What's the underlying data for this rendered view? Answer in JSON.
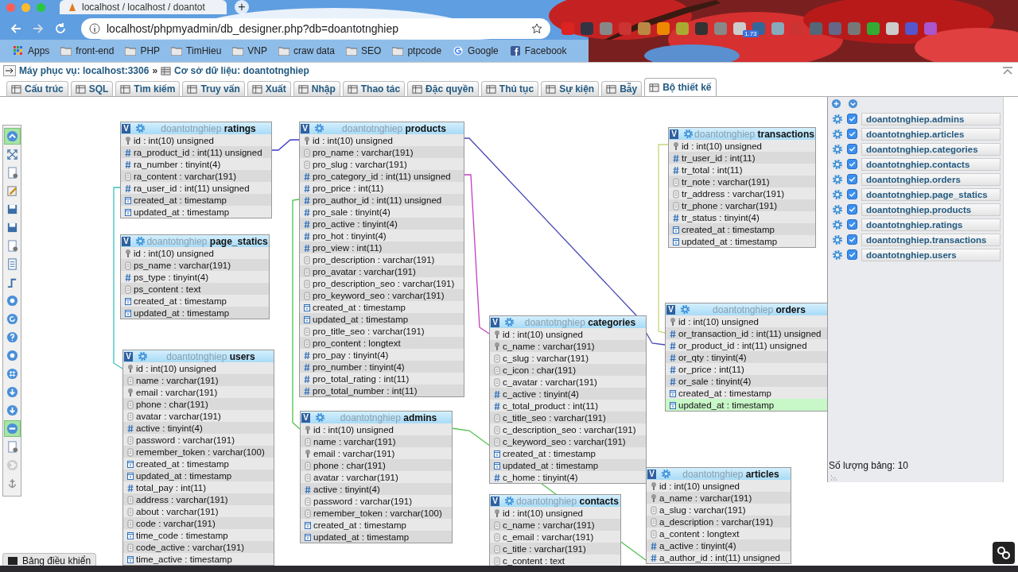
{
  "browser": {
    "tab_title": "localhost / localhost / doantot",
    "new_tab": "+",
    "url": "localhost/phpmyadmin/db_designer.php?db=doantotnghiep",
    "extension_badge": "1.73",
    "bookmarks": [
      {
        "kind": "apps",
        "label": "Apps"
      },
      {
        "kind": "folder",
        "label": "front-end"
      },
      {
        "kind": "folder",
        "label": "PHP"
      },
      {
        "kind": "folder",
        "label": "TimHieu"
      },
      {
        "kind": "folder",
        "label": "VNP"
      },
      {
        "kind": "folder",
        "label": "craw data"
      },
      {
        "kind": "folder",
        "label": "SEO"
      },
      {
        "kind": "folder",
        "label": "ptpcode"
      },
      {
        "kind": "google",
        "label": "Google"
      },
      {
        "kind": "facebook",
        "label": "Facebook"
      }
    ]
  },
  "breadcrumb": {
    "server": "Máy phục vụ: localhost:3306",
    "separator": "»",
    "database": "Cơ sở dữ liệu: doantotnghiep"
  },
  "tabs": [
    {
      "label": "Cấu trúc",
      "selected": false
    },
    {
      "label": "SQL",
      "selected": false
    },
    {
      "label": "Tìm kiếm",
      "selected": false
    },
    {
      "label": "Truy vấn",
      "selected": false
    },
    {
      "label": "Xuất",
      "selected": false
    },
    {
      "label": "Nhập",
      "selected": false
    },
    {
      "label": "Thao tác",
      "selected": false
    },
    {
      "label": "Đặc quyền",
      "selected": false
    },
    {
      "label": "Thủ tục",
      "selected": false
    },
    {
      "label": "Sự kiện",
      "selected": false
    },
    {
      "label": "Bẫy",
      "selected": false
    },
    {
      "label": "Bộ thiết kế",
      "selected": true
    }
  ],
  "left_toolbar": [
    {
      "selected": true
    },
    {
      "selected": false
    },
    {
      "selected": false
    },
    {
      "selected": false
    },
    {
      "selected": false
    },
    {
      "selected": false
    },
    {
      "selected": false
    },
    {
      "selected": false
    },
    {
      "selected": false
    },
    {
      "selected": false
    },
    {
      "selected": false
    },
    {
      "selected": false
    },
    {
      "selected": false
    },
    {
      "selected": false
    },
    {
      "selected": false
    },
    {
      "selected": false
    },
    {
      "selected": true
    },
    {
      "selected": false
    },
    {
      "selected": false
    },
    {
      "selected": false
    }
  ],
  "tables": [
    {
      "toggle": "V",
      "database": "doantotnghiep",
      "name": "ratings",
      "fields": [
        {
          "kind": "key",
          "text": "id : int(10) unsigned"
        },
        {
          "kind": "number",
          "text": "ra_product_id : int(11) unsigned"
        },
        {
          "kind": "number",
          "text": "ra_number : tinyint(4)"
        },
        {
          "kind": "text",
          "text": "ra_content : varchar(191)"
        },
        {
          "kind": "number",
          "text": "ra_user_id : int(11) unsigned"
        },
        {
          "kind": "date",
          "text": "created_at : timestamp"
        },
        {
          "kind": "date",
          "text": "updated_at : timestamp"
        }
      ]
    },
    {
      "toggle": "V",
      "database": "doantotnghiep",
      "name": "products",
      "fields": [
        {
          "kind": "key",
          "text": "id : int(10) unsigned"
        },
        {
          "kind": "text",
          "text": "pro_name : varchar(191)"
        },
        {
          "kind": "text",
          "text": "pro_slug : varchar(191)"
        },
        {
          "kind": "number",
          "text": "pro_category_id : int(11) unsigned"
        },
        {
          "kind": "number",
          "text": "pro_price : int(11)"
        },
        {
          "kind": "number",
          "text": "pro_author_id : int(11) unsigned"
        },
        {
          "kind": "number",
          "text": "pro_sale : tinyint(4)"
        },
        {
          "kind": "number",
          "text": "pro_active : tinyint(4)"
        },
        {
          "kind": "number",
          "text": "pro_hot : tinyint(4)"
        },
        {
          "kind": "number",
          "text": "pro_view : int(11)"
        },
        {
          "kind": "text",
          "text": "pro_description : varchar(191)"
        },
        {
          "kind": "text",
          "text": "pro_avatar : varchar(191)"
        },
        {
          "kind": "text",
          "text": "pro_description_seo : varchar(191)"
        },
        {
          "kind": "text",
          "text": "pro_keyword_seo : varchar(191)"
        },
        {
          "kind": "date",
          "text": "created_at : timestamp"
        },
        {
          "kind": "date",
          "text": "updated_at : timestamp"
        },
        {
          "kind": "text",
          "text": "pro_title_seo : varchar(191)"
        },
        {
          "kind": "text",
          "text": "pro_content : longtext"
        },
        {
          "kind": "number",
          "text": "pro_pay : tinyint(4)"
        },
        {
          "kind": "number",
          "text": "pro_number : tinyint(4)"
        },
        {
          "kind": "number",
          "text": "pro_total_rating : int(11)"
        },
        {
          "kind": "number",
          "text": "pro_total_number : int(11)"
        }
      ]
    },
    {
      "toggle": "V",
      "database": "doantotnghiep",
      "name": "transactions",
      "fields": [
        {
          "kind": "key",
          "text": "id : int(10) unsigned"
        },
        {
          "kind": "number",
          "text": "tr_user_id : int(11)"
        },
        {
          "kind": "number",
          "text": "tr_total : int(11)"
        },
        {
          "kind": "text",
          "text": "tr_note : varchar(191)"
        },
        {
          "kind": "text",
          "text": "tr_address : varchar(191)"
        },
        {
          "kind": "text",
          "text": "tr_phone : varchar(191)"
        },
        {
          "kind": "number",
          "text": "tr_status : tinyint(4)"
        },
        {
          "kind": "date",
          "text": "created_at : timestamp"
        },
        {
          "kind": "date",
          "text": "updated_at : timestamp"
        }
      ]
    },
    {
      "toggle": "V",
      "database": "doantotnghiep",
      "name": "page_statics",
      "fields": [
        {
          "kind": "key",
          "text": "id : int(10) unsigned"
        },
        {
          "kind": "text",
          "text": "ps_name : varchar(191)"
        },
        {
          "kind": "number",
          "text": "ps_type : tinyint(4)"
        },
        {
          "kind": "text",
          "text": "ps_content : text"
        },
        {
          "kind": "date",
          "text": "created_at : timestamp"
        },
        {
          "kind": "date",
          "text": "updated_at : timestamp"
        }
      ]
    },
    {
      "toggle": "V",
      "database": "doantotnghiep",
      "name": "orders",
      "fields": [
        {
          "kind": "key",
          "text": "id : int(10) unsigned",
          "selected": false
        },
        {
          "kind": "number",
          "text": "or_transaction_id : int(11) unsigned",
          "selected": false
        },
        {
          "kind": "number",
          "text": "or_product_id : int(11) unsigned",
          "selected": false
        },
        {
          "kind": "number",
          "text": "or_qty : tinyint(4)",
          "selected": false
        },
        {
          "kind": "number",
          "text": "or_price : int(11)",
          "selected": false
        },
        {
          "kind": "number",
          "text": "or_sale : tinyint(4)",
          "selected": false
        },
        {
          "kind": "date",
          "text": "created_at : timestamp",
          "selected": false
        },
        {
          "kind": "date",
          "text": "updated_at : timestamp",
          "selected": true
        }
      ]
    },
    {
      "toggle": "V",
      "database": "doantotnghiep",
      "name": "categories",
      "fields": [
        {
          "kind": "key",
          "text": "id : int(10) unsigned"
        },
        {
          "kind": "key",
          "text": "c_name : varchar(191)"
        },
        {
          "kind": "text",
          "text": "c_slug : varchar(191)"
        },
        {
          "kind": "text",
          "text": "c_icon : char(191)"
        },
        {
          "kind": "text",
          "text": "c_avatar : varchar(191)"
        },
        {
          "kind": "number",
          "text": "c_active : tinyint(4)"
        },
        {
          "kind": "number",
          "text": "c_total_product : int(11)"
        },
        {
          "kind": "text",
          "text": "c_title_seo : varchar(191)"
        },
        {
          "kind": "text",
          "text": "c_description_seo : varchar(191)"
        },
        {
          "kind": "text",
          "text": "c_keyword_seo : varchar(191)"
        },
        {
          "kind": "date",
          "text": "created_at : timestamp"
        },
        {
          "kind": "date",
          "text": "updated_at : timestamp"
        },
        {
          "kind": "number",
          "text": "c_home : tinyint(4)"
        }
      ]
    },
    {
      "toggle": "V",
      "database": "doantotnghiep",
      "name": "users",
      "fields": [
        {
          "kind": "key",
          "text": "id : int(10) unsigned"
        },
        {
          "kind": "text",
          "text": "name : varchar(191)"
        },
        {
          "kind": "key",
          "text": "email : varchar(191)"
        },
        {
          "kind": "text",
          "text": "phone : char(191)"
        },
        {
          "kind": "text",
          "text": "avatar : varchar(191)"
        },
        {
          "kind": "number",
          "text": "active : tinyint(4)"
        },
        {
          "kind": "text",
          "text": "password : varchar(191)"
        },
        {
          "kind": "text",
          "text": "remember_token : varchar(100)"
        },
        {
          "kind": "date",
          "text": "created_at : timestamp"
        },
        {
          "kind": "date",
          "text": "updated_at : timestamp"
        },
        {
          "kind": "number",
          "text": "total_pay : int(11)"
        },
        {
          "kind": "text",
          "text": "address : varchar(191)"
        },
        {
          "kind": "text",
          "text": "about : varchar(191)"
        },
        {
          "kind": "text",
          "text": "code : varchar(191)"
        },
        {
          "kind": "date",
          "text": "time_code : timestamp"
        },
        {
          "kind": "text",
          "text": "code_active : varchar(191)"
        },
        {
          "kind": "date",
          "text": "time_active : timestamp"
        }
      ]
    },
    {
      "toggle": "V",
      "database": "doantotnghiep",
      "name": "admins",
      "fields": [
        {
          "kind": "key",
          "text": "id : int(10) unsigned"
        },
        {
          "kind": "text",
          "text": "name : varchar(191)"
        },
        {
          "kind": "key",
          "text": "email : varchar(191)"
        },
        {
          "kind": "text",
          "text": "phone : char(191)"
        },
        {
          "kind": "text",
          "text": "avatar : varchar(191)"
        },
        {
          "kind": "number",
          "text": "active : tinyint(4)"
        },
        {
          "kind": "text",
          "text": "password : varchar(191)"
        },
        {
          "kind": "text",
          "text": "remember_token : varchar(100)"
        },
        {
          "kind": "date",
          "text": "created_at : timestamp"
        },
        {
          "kind": "date",
          "text": "updated_at : timestamp"
        }
      ]
    },
    {
      "toggle": "V",
      "database": "doantotnghiep",
      "name": "contacts",
      "fields": [
        {
          "kind": "key",
          "text": "id : int(10) unsigned"
        },
        {
          "kind": "text",
          "text": "c_name : varchar(191)"
        },
        {
          "kind": "text",
          "text": "c_email : varchar(191)"
        },
        {
          "kind": "text",
          "text": "c_title : varchar(191)"
        },
        {
          "kind": "text",
          "text": "c_content : text"
        }
      ]
    },
    {
      "toggle": "V",
      "database": "doantotnghiep",
      "name": "articles",
      "fields": [
        {
          "kind": "key",
          "text": "id : int(10) unsigned"
        },
        {
          "kind": "key",
          "text": "a_name : varchar(191)"
        },
        {
          "kind": "text",
          "text": "a_slug : varchar(191)"
        },
        {
          "kind": "text",
          "text": "a_description : varchar(191)"
        },
        {
          "kind": "text",
          "text": "a_content : longtext"
        },
        {
          "kind": "number",
          "text": "a_active : tinyint(4)"
        },
        {
          "kind": "number",
          "text": "a_author_id : int(11) unsigned"
        }
      ]
    }
  ],
  "side_panel": {
    "tables": [
      {
        "checked": true,
        "label": "doantotnghiep.admins"
      },
      {
        "checked": true,
        "label": "doantotnghiep.articles"
      },
      {
        "checked": true,
        "label": "doantotnghiep.categories"
      },
      {
        "checked": true,
        "label": "doantotnghiep.contacts"
      },
      {
        "checked": true,
        "label": "doantotnghiep.orders"
      },
      {
        "checked": true,
        "label": "doantotnghiep.page_statics"
      },
      {
        "checked": true,
        "label": "doantotnghiep.products"
      },
      {
        "checked": true,
        "label": "doantotnghiep.ratings"
      },
      {
        "checked": true,
        "label": "doantotnghiep.transactions"
      },
      {
        "checked": true,
        "label": "doantotnghiep.users"
      }
    ],
    "count": "Số lượng bảng: 10"
  },
  "bottom_panel": {
    "label": "Bảng điều khiển"
  }
}
